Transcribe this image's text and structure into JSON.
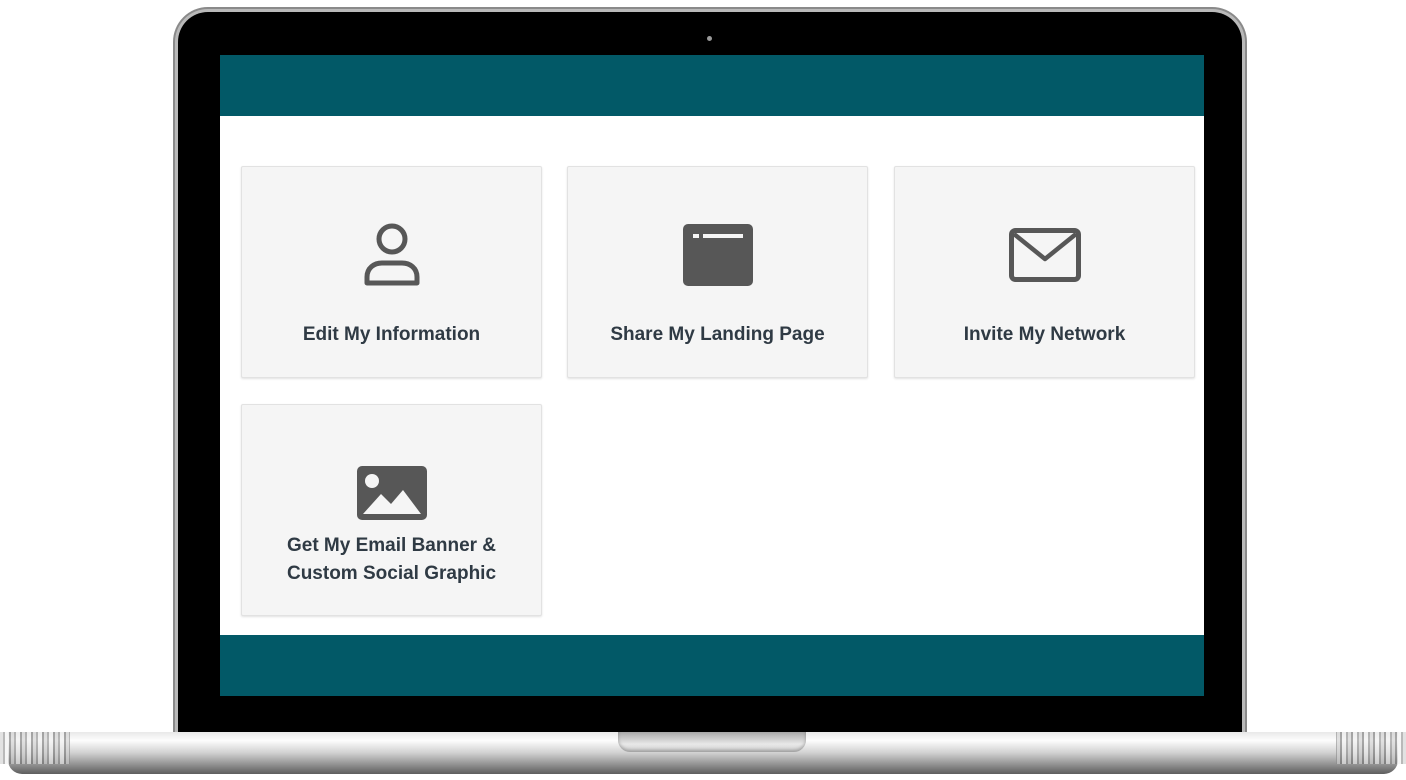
{
  "colors": {
    "header_bar": "#025967",
    "footer_bar": "#025967",
    "tile_background": "#f5f5f5",
    "icon_color": "#575757",
    "label_color": "#2f3a44"
  },
  "tiles": [
    {
      "label": "Edit My Information",
      "icon": "user-icon"
    },
    {
      "label": "Share My Landing Page",
      "icon": "browser-window-icon"
    },
    {
      "label": "Invite My Network",
      "icon": "envelope-icon"
    },
    {
      "label_line1": "Get My Email Banner &",
      "label_line2": "Custom Social Graphic",
      "icon": "image-icon"
    }
  ]
}
